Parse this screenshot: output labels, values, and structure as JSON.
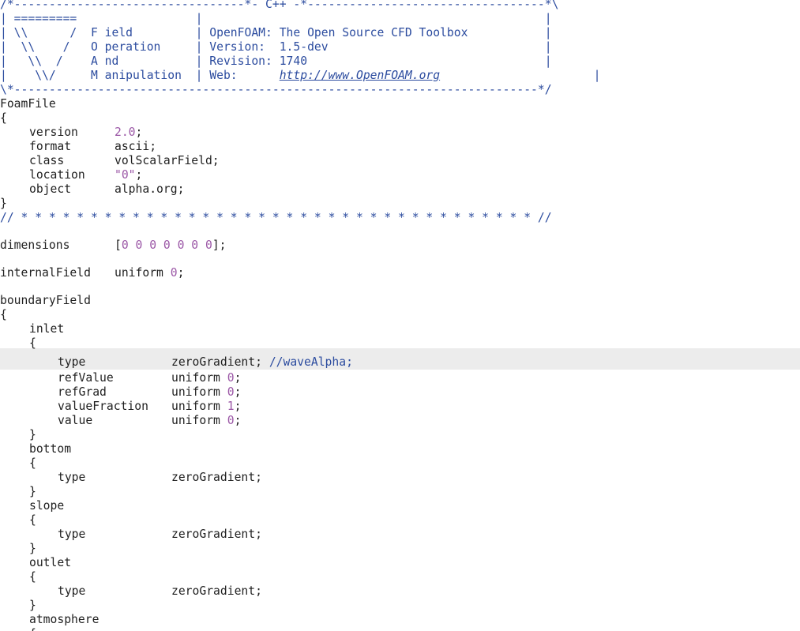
{
  "header": {
    "top_border": "/*---------------------------------*- C++ -*----------------------------------*\\",
    "bottom_border": "\\*---------------------------------------------------------------------------*/",
    "rows": [
      {
        "art": "| =========                 ",
        "info": "|",
        "tail": "                                                 |"
      },
      {
        "art": "| \\\\      /  F ield         ",
        "info": "| OpenFOAM: The Open Source CFD Toolbox           ",
        "tail": "|"
      },
      {
        "art": "|  \\\\    /   O peration     ",
        "info": "| Version:  1.5-dev                               ",
        "tail": "|"
      },
      {
        "art": "|   \\\\  /    A nd           ",
        "info": "| Revision: 1740                                  ",
        "tail": "|"
      },
      {
        "art": "|    \\\\/     M anipulation  ",
        "info": "| Web:      ",
        "url": "http://www.OpenFOAM.org",
        "tail": "                      |"
      }
    ]
  },
  "foamfile": {
    "title": "FoamFile",
    "open": "{",
    "close": "}",
    "entries": [
      {
        "key": "version",
        "value": "2.0",
        "end": ";"
      },
      {
        "key": "format",
        "value": "ascii",
        "end": ";"
      },
      {
        "key": "class",
        "value": "volScalarField",
        "end": ";"
      },
      {
        "key": "location",
        "value": "\"0\"",
        "end": ";"
      },
      {
        "key": "object",
        "value": "alpha.org",
        "end": ";"
      }
    ]
  },
  "separator": "// * * * * * * * * * * * * * * * * * * * * * * * * * * * * * * * * * * * * * //",
  "dimensions": {
    "key": "dimensions",
    "open": "[",
    "values": "0 0 0 0 0 0 0",
    "close": "];"
  },
  "internal_field": {
    "key": "internalField",
    "word": "uniform",
    "value": "0",
    "end": ";"
  },
  "boundary": {
    "title": "boundaryField",
    "open": "{",
    "inlet": {
      "name": "inlet",
      "open": "{",
      "close": "}",
      "type_key": "type",
      "type_value": "zeroGradient;",
      "comment": "//waveAlpha;",
      "entries": [
        {
          "key": "refValue",
          "word": "uniform",
          "value": "0",
          "end": ";"
        },
        {
          "key": "refGrad",
          "word": "uniform",
          "value": "0",
          "end": ";"
        },
        {
          "key": "valueFraction",
          "word": "uniform",
          "value": "1",
          "end": ";"
        },
        {
          "key": "value",
          "word": "uniform",
          "value": "0",
          "end": ";"
        }
      ]
    },
    "patches": [
      {
        "name": "bottom",
        "open": "{",
        "type_key": "type",
        "type_value": "zeroGradient;",
        "close": "}"
      },
      {
        "name": "slope",
        "open": "{",
        "type_key": "type",
        "type_value": "zeroGradient;",
        "close": "}"
      },
      {
        "name": "outlet",
        "open": "{",
        "type_key": "type",
        "type_value": "zeroGradient;",
        "close": "}"
      }
    ],
    "last_patch": {
      "name": "atmosphere",
      "open": "{"
    }
  }
}
